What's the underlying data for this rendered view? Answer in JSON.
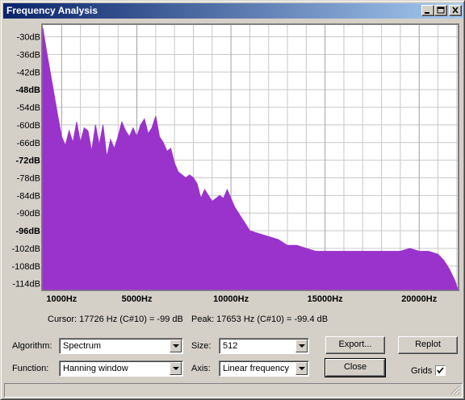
{
  "window": {
    "title": "Frequency Analysis"
  },
  "chart_data": {
    "type": "area",
    "ylim": [
      -116,
      -26
    ],
    "xlim": [
      0,
      22050
    ],
    "yticks": [
      "-30dB",
      "-36dB",
      "-42dB",
      "-48dB",
      "-54dB",
      "-60dB",
      "-66dB",
      "-72dB",
      "-78dB",
      "-84dB",
      "-90dB",
      "-96dB",
      "-102dB",
      "-108dB",
      "-114dB"
    ],
    "ytick_values": [
      -30,
      -36,
      -42,
      -48,
      -54,
      -60,
      -66,
      -72,
      -78,
      -84,
      -90,
      -96,
      -102,
      -108,
      -114
    ],
    "bold_yticks": [
      "-48dB",
      "-72dB",
      "-96dB"
    ],
    "xticks": [
      "1000Hz",
      "5000Hz",
      "10000Hz",
      "15000Hz",
      "20000Hz"
    ],
    "xtick_values": [
      1000,
      5000,
      10000,
      15000,
      20000
    ],
    "grid": true,
    "fill_color": "#9933cc",
    "x": [
      0,
      200,
      500,
      800,
      1000,
      1200,
      1400,
      1600,
      1800,
      2000,
      2200,
      2400,
      2600,
      2800,
      3000,
      3200,
      3400,
      3600,
      3800,
      4000,
      4200,
      4400,
      4600,
      4800,
      5000,
      5200,
      5400,
      5600,
      5800,
      6000,
      6200,
      6400,
      6600,
      6800,
      7000,
      7200,
      7400,
      7600,
      7800,
      8000,
      8200,
      8400,
      8600,
      8800,
      9000,
      9200,
      9400,
      9600,
      9800,
      10000,
      10200,
      10400,
      10600,
      10800,
      11000,
      11500,
      12000,
      12500,
      13000,
      13500,
      14000,
      14500,
      15000,
      16000,
      17000,
      18000,
      19000,
      19500,
      20000,
      20500,
      21000,
      21300,
      21600,
      21900,
      22050
    ],
    "values": [
      -27,
      -35,
      -46,
      -57,
      -64,
      -67,
      -62,
      -66,
      -59,
      -66,
      -61,
      -62,
      -69,
      -60,
      -67,
      -60,
      -71,
      -65,
      -68,
      -64,
      -59,
      -62,
      -64,
      -61,
      -64,
      -60,
      -58,
      -63,
      -61,
      -57,
      -64,
      -66,
      -69,
      -68,
      -73,
      -76,
      -77,
      -78,
      -77,
      -78,
      -80,
      -85,
      -82,
      -84,
      -86,
      -85,
      -84,
      -85,
      -82,
      -85,
      -88,
      -90,
      -92,
      -94,
      -96,
      -97,
      -98,
      -99,
      -101,
      -101,
      -102,
      -103,
      -103,
      -103,
      -103,
      -103,
      -103,
      -102,
      -103,
      -103,
      -104,
      -106,
      -109,
      -113,
      -116
    ]
  },
  "status": {
    "cursor": "Cursor: 17726 Hz (C#10) = -99 dB",
    "peak": "Peak: 17653 Hz (C#10) = -99.4 dB"
  },
  "controls": {
    "algorithm_label": "Algorithm:",
    "algorithm_value": "Spectrum",
    "function_label": "Function:",
    "function_value": "Hanning window",
    "size_label": "Size:",
    "size_value": "512",
    "axis_label": "Axis:",
    "axis_value": "Linear frequency",
    "export_label": "Export...",
    "replot_label": "Replot",
    "close_label": "Close",
    "grids_label": "Grids",
    "grids_checked": true
  }
}
